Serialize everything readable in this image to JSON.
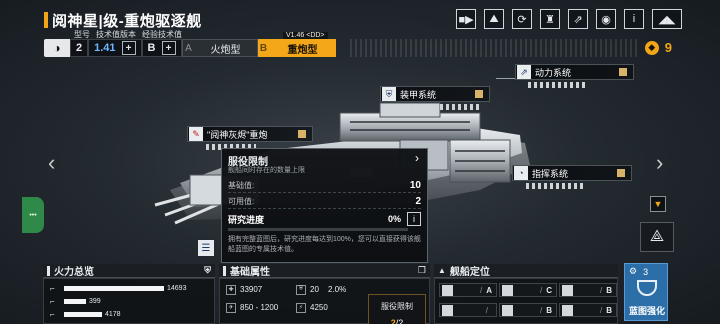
{
  "title": "阅神星|级-重炮驱逐舰",
  "toolbar": {
    "icons": [
      "video-icon",
      "image-icon",
      "refresh-icon",
      "mech-icon",
      "share-icon",
      "eye-icon",
      "info-icon",
      "back-icon"
    ],
    "glyphs": [
      "■▶",
      "⛰",
      "⟳",
      "♜",
      "⇗",
      "◉",
      "i",
      "◢◣"
    ]
  },
  "spec": {
    "labels": [
      "型号",
      "技术值版本",
      "经验技术值"
    ],
    "model_num": "2",
    "tech_version": "1.41",
    "exp_grade": "B",
    "plus": "+"
  },
  "ship_types": {
    "a_letter": "A",
    "a_label": "火炮型",
    "b_letter": "B",
    "b_label": "重炮型",
    "version_tag": "V1.46 <DD>"
  },
  "currency": {
    "value": "9"
  },
  "systems": {
    "power": "动力系统",
    "armor": "装甲系统",
    "cannon": "\"阋神灰烬\"重炮",
    "command": "指挥系统"
  },
  "tooltip": {
    "title": "服役限制",
    "subtitle": "舰船同时存在的数量上限",
    "base_label": "基础值:",
    "base_value": "10",
    "available_label": "可用值:",
    "available_value": "2",
    "research_label": "研究进度",
    "research_value": "0%",
    "research_progress": 0,
    "description": "拥有完整蓝图后，研究进度每达到100%，您可以直接获得该舰船蓝图的专属技术值。",
    "info_glyph": "i",
    "chevron": "›"
  },
  "side_widget": "•••",
  "firepower": {
    "title": "火力总览",
    "rows": [
      {
        "value": "14693",
        "ratio": 1.0
      },
      {
        "value": "399",
        "ratio": 0.22
      },
      {
        "value": "4178",
        "ratio": 0.38
      }
    ]
  },
  "basic": {
    "title": "基础属性",
    "hp": "33907",
    "armor": "20",
    "evasion": "2.0%",
    "speed": "850 - 1200",
    "energy": "4250",
    "service_label": "服役限制",
    "service_current": "2",
    "service_max": "/2"
  },
  "position": {
    "title": "舰船定位",
    "slots": [
      {
        "label": "/",
        "grade": "A"
      },
      {
        "label": "/",
        "grade": "C"
      },
      {
        "label": "/",
        "grade": "B"
      },
      {
        "label": "/",
        "grade": ""
      },
      {
        "label": "/",
        "grade": "B"
      },
      {
        "label": "/",
        "grade": "B"
      }
    ]
  },
  "blueprint": {
    "count": "3",
    "label": "蓝图强化"
  },
  "colors": {
    "accent": "#f2a516",
    "blue": "#6fb7ff",
    "blueprint": "#2c6ea8"
  }
}
